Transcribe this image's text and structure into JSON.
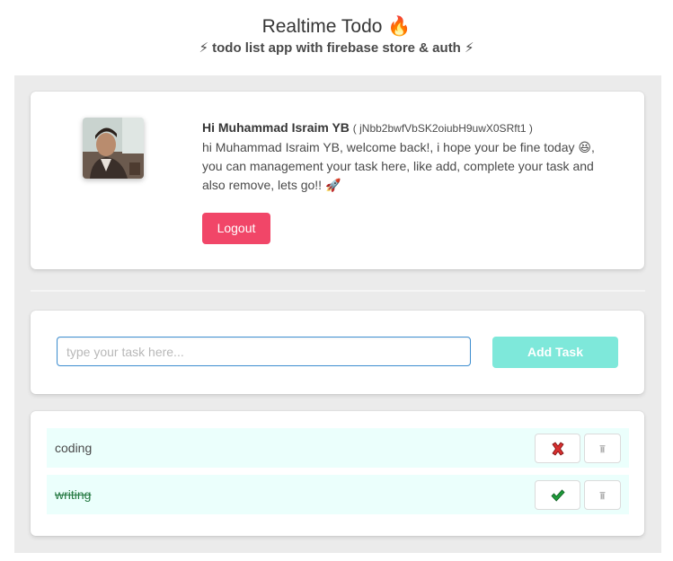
{
  "header": {
    "title": "Realtime Todo 🔥",
    "subtitle": "⚡ todo list app with firebase store & auth ⚡"
  },
  "profile": {
    "greeting": "Hi Muhammad Israim YB",
    "uid": "( jNbb2bwfVbSK2oiubH9uwX0SRft1 )",
    "welcome": "hi Muhammad Israim YB, welcome back!, i hope your be fine today 😆, you can management your task here, like add, complete your task and also remove, lets go!! 🚀",
    "logout_label": "Logout"
  },
  "add_task": {
    "placeholder": "type your task here...",
    "value": "",
    "button_label": "Add Task"
  },
  "tasks": [
    {
      "text": "coding",
      "completed": false
    },
    {
      "text": "writing",
      "completed": true
    }
  ],
  "colors": {
    "danger": "#f14668",
    "primary_light": "#7ee8da",
    "row_bg": "#ebfffc",
    "done_text": "#257942"
  }
}
